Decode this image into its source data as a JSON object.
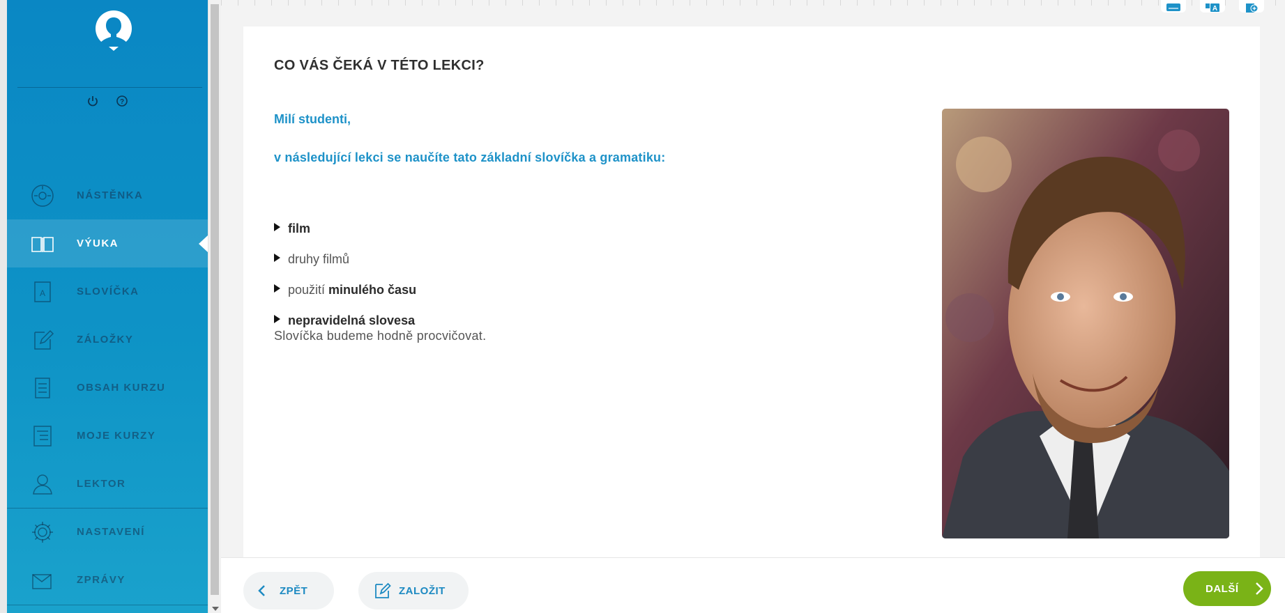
{
  "sidebar": {
    "utility": {
      "power_icon": "power-icon",
      "help_icon": "help-icon"
    },
    "items": [
      {
        "label": "NÁSTĚNKA",
        "icon": "dashboard-icon"
      },
      {
        "label": "VÝUKA",
        "icon": "book-icon"
      },
      {
        "label": "SLOVÍČKA",
        "icon": "vocabulary-icon"
      },
      {
        "label": "ZÁLOŽKY",
        "icon": "bookmark-edit-icon"
      },
      {
        "label": "OBSAH KURZU",
        "icon": "document-icon"
      },
      {
        "label": "MOJE KURZY",
        "icon": "course-list-icon"
      },
      {
        "label": "LEKTOR",
        "icon": "person-icon"
      },
      {
        "label": "NASTAVENÍ",
        "icon": "gear-icon"
      },
      {
        "label": "ZPRÁVY",
        "icon": "message-icon"
      }
    ],
    "active_item": "VÝUKA"
  },
  "toolbar": {
    "icons": [
      "keyboard-icon",
      "translate-icon",
      "add-page-icon"
    ]
  },
  "lesson": {
    "title": "CO VÁS ČEKÁ V TÉTO LEKCI?",
    "greeting": "Milí studenti,",
    "intro": "v následující lekci se naučíte tato základní slovíčka a gramatiku:",
    "bullets": {
      "b1": "film",
      "b2": "druhy filmů",
      "b3_prefix": "použití ",
      "b3_bold": "minulého času",
      "b4": "nepravidelná slovesa"
    },
    "closing": "Slovíčka budeme hodně procvičovat."
  },
  "footer": {
    "back_label": "ZPĚT",
    "bookmark_label": "ZALOŽIT",
    "next_label": "DALŠÍ"
  },
  "colors": {
    "sidebar": "#0a87c4",
    "accent": "#1e92c8",
    "next_button": "#7ab317"
  }
}
